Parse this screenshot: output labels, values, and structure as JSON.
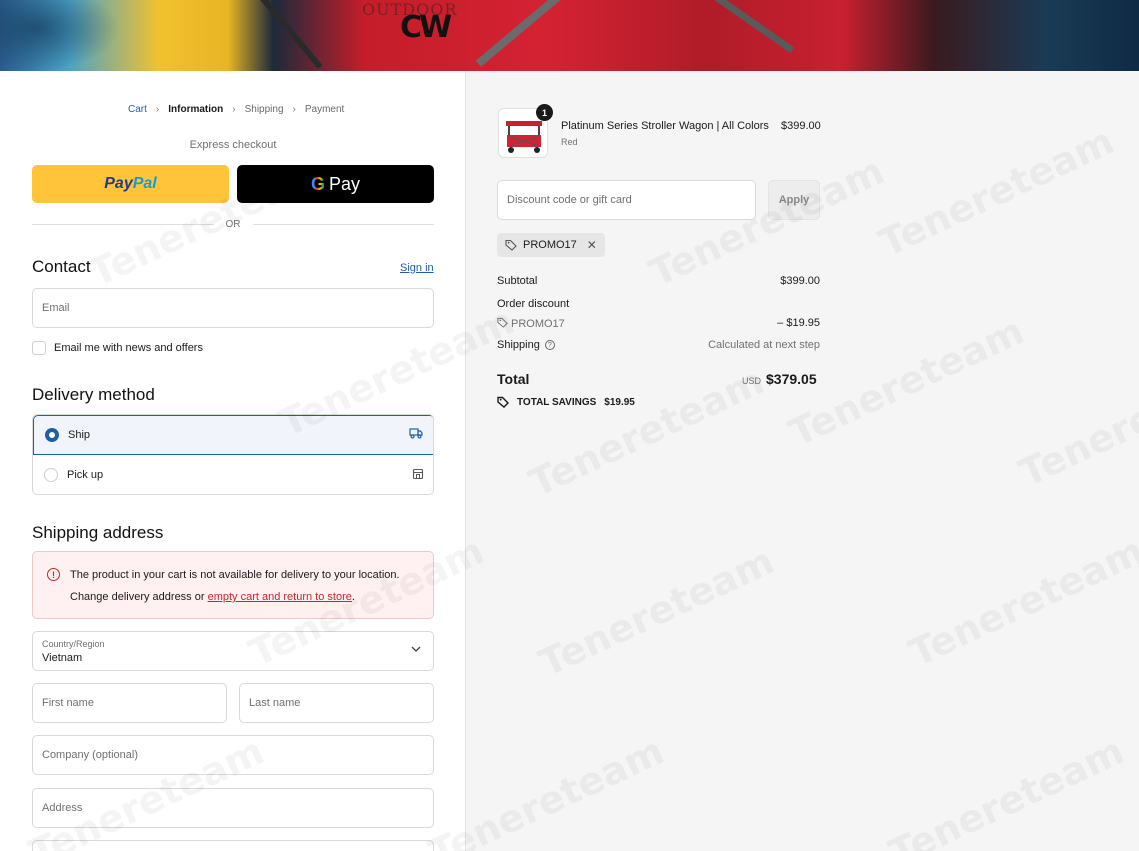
{
  "banner": {
    "brand_text": "OUTDOOR",
    "logo": "CW"
  },
  "breadcrumb": {
    "cart": "Cart",
    "information": "Information",
    "shipping": "Shipping",
    "payment": "Payment"
  },
  "express": {
    "label": "Express checkout",
    "paypal_1": "Pay",
    "paypal_2": "Pal",
    "gpay_g": "G",
    "gpay_text": "Pay",
    "or": "OR"
  },
  "contact": {
    "title": "Contact",
    "signin": "Sign in",
    "email_placeholder": "Email",
    "news_label": "Email me with news and offers"
  },
  "delivery": {
    "title": "Delivery method",
    "ship": "Ship",
    "pickup": "Pick up"
  },
  "shipping_address": {
    "title": "Shipping address",
    "alert_line1": "The product in your cart is not available for delivery to your location.",
    "alert_line2_prefix": "Change delivery address or ",
    "alert_link": "empty cart and return to store",
    "alert_suffix": ".",
    "country_label": "Country/Region",
    "country_value": "Vietnam",
    "first_name": "First name",
    "last_name": "Last name",
    "company": "Company (optional)",
    "address": "Address"
  },
  "summary": {
    "qty": "1",
    "product_name": "Platinum Series Stroller Wagon | All Colors",
    "variant": "Red",
    "price": "$399.00",
    "discount_placeholder": "Discount code or gift card",
    "apply": "Apply",
    "promo_code": "PROMO17",
    "subtotal_label": "Subtotal",
    "subtotal": "$399.00",
    "order_discount_label": "Order discount",
    "discount_code": "PROMO17",
    "discount_value": "– $19.95",
    "shipping_label": "Shipping",
    "shipping_value": "Calculated at next step",
    "total_label": "Total",
    "currency": "USD",
    "total": "$379.05",
    "savings_label": "TOTAL SAVINGS",
    "savings_value": "$19.95"
  },
  "watermark": "Tenereteam",
  "colors": {
    "accent": "#1f5fa8",
    "paypal": "#ffc439",
    "alert": "#c62828"
  }
}
